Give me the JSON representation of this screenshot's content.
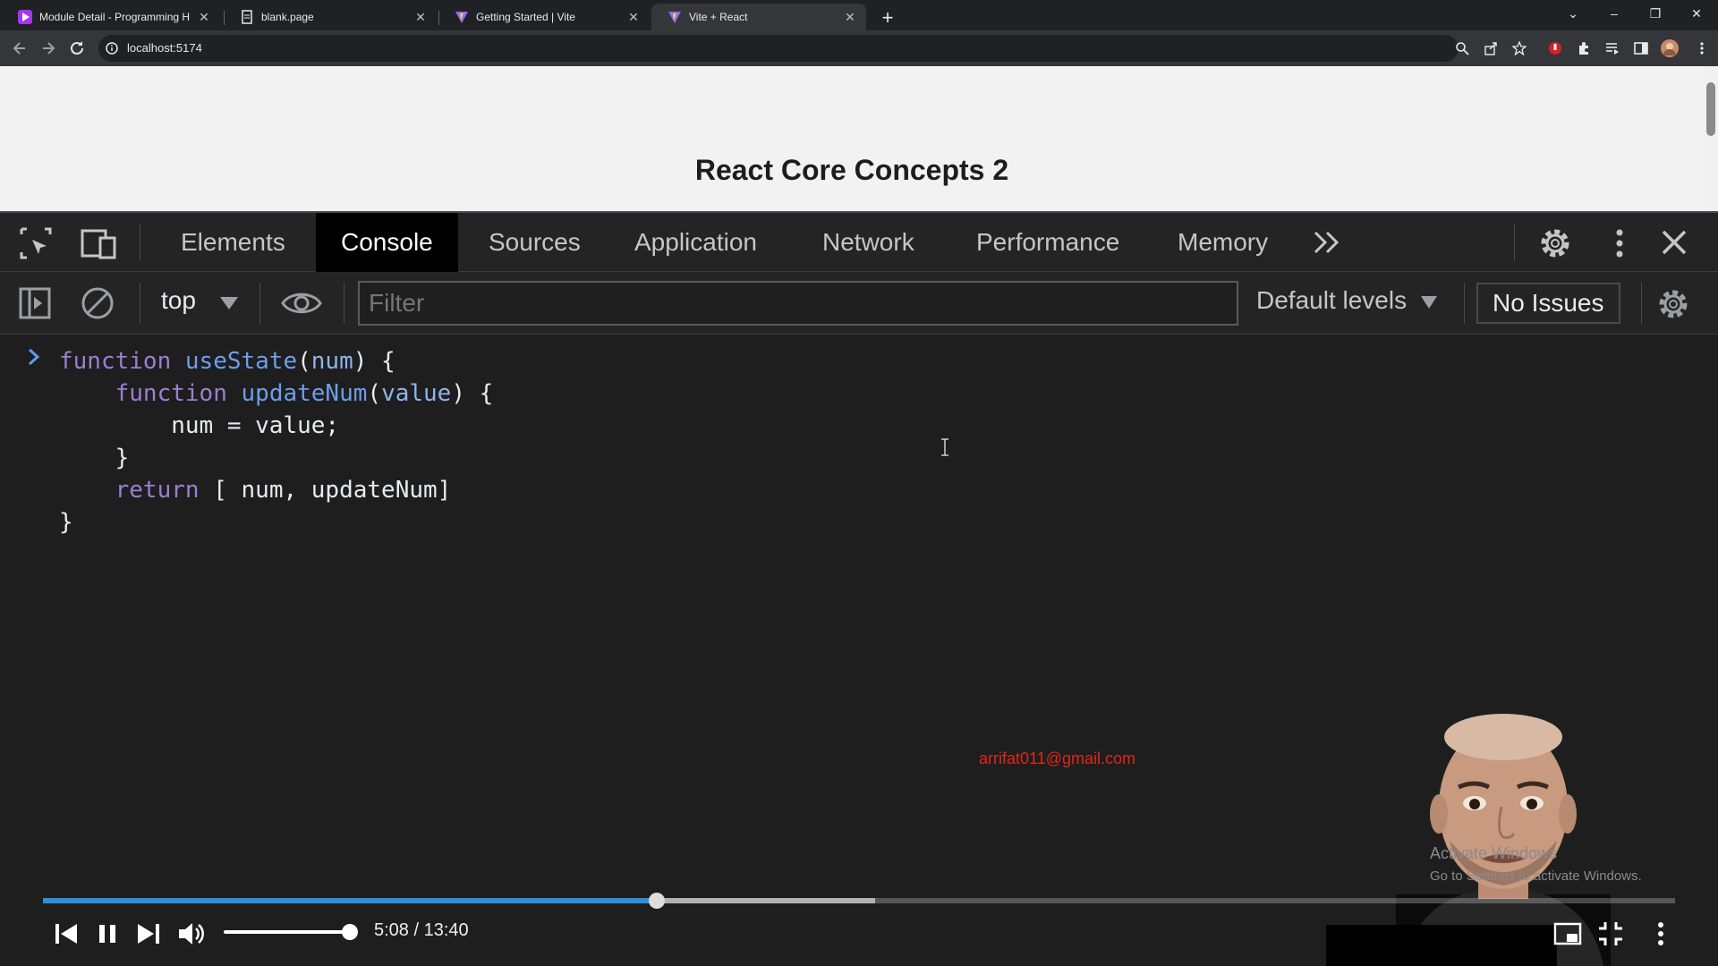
{
  "browser": {
    "tabs": [
      {
        "title": "Module Detail - Programming H",
        "favicon": "purple-play-icon",
        "active": false
      },
      {
        "title": "blank.page",
        "favicon": "page-icon",
        "active": false
      },
      {
        "title": "Getting Started | Vite",
        "favicon": "vite-icon",
        "active": false
      },
      {
        "title": "Vite + React",
        "favicon": "vite-icon",
        "active": true
      }
    ],
    "url": "localhost:5174"
  },
  "page": {
    "title": "React Core Concepts 2"
  },
  "devtools": {
    "tabs": [
      "Elements",
      "Console",
      "Sources",
      "Application",
      "Network",
      "Performance",
      "Memory"
    ],
    "active_tab": "Console",
    "context": "top",
    "filter_placeholder": "Filter",
    "levels": "Default levels",
    "issues": "No Issues"
  },
  "console": {
    "code": {
      "l1_kw": "function",
      "l1_fn": "useState",
      "l1_open": "(",
      "l1_prm": "num",
      "l1_close": ") {",
      "l2_kw": "function",
      "l2_fn": "updateNum",
      "l2_open": "(",
      "l2_prm": "value",
      "l2_close": ") {",
      "l3": "num = value;",
      "l4": "}",
      "l5_kw": "return",
      "l5_rest": "[ num, updateNum]",
      "l6": "}"
    }
  },
  "overlay": {
    "email": "arrifat011@gmail.com",
    "watermark_title": "Activate Windows",
    "watermark_sub": "Go to Settings to activate Windows."
  },
  "player": {
    "time": "5:08 / 13:40",
    "progress": 0.376,
    "buffered": 0.51,
    "volume": 1.0
  }
}
